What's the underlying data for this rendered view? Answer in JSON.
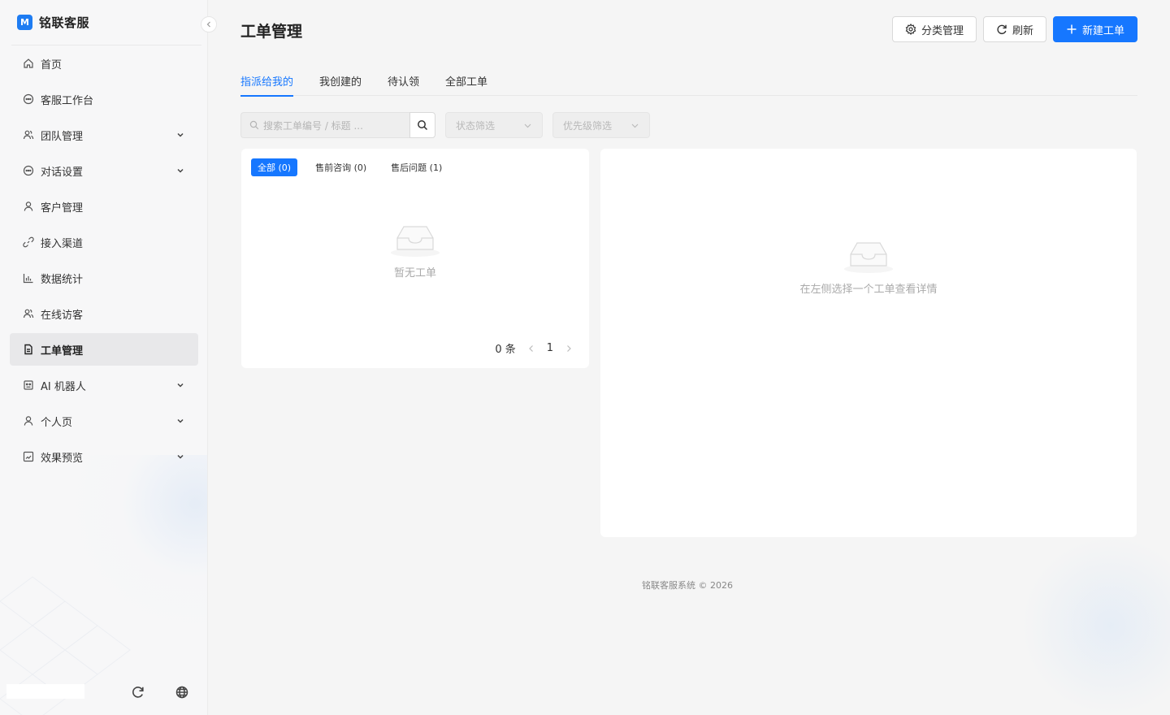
{
  "app": {
    "logo_mark": "M",
    "name": "铭联客服"
  },
  "sidebar": {
    "items": [
      {
        "label": "首页",
        "icon": "home-icon"
      },
      {
        "label": "客服工作台",
        "icon": "chat-icon"
      },
      {
        "label": "团队管理",
        "icon": "team-icon",
        "expandable": true
      },
      {
        "label": "对话设置",
        "icon": "chat-settings-icon",
        "expandable": true
      },
      {
        "label": "客户管理",
        "icon": "user-icon"
      },
      {
        "label": "接入渠道",
        "icon": "link-icon"
      },
      {
        "label": "数据统计",
        "icon": "bar-chart-icon"
      },
      {
        "label": "在线访客",
        "icon": "visitor-icon"
      },
      {
        "label": "工单管理",
        "icon": "ticket-icon",
        "active": true
      },
      {
        "label": "AI 机器人",
        "icon": "robot-icon",
        "expandable": true
      },
      {
        "label": "个人页",
        "icon": "profile-icon",
        "expandable": true
      },
      {
        "label": "效果预览",
        "icon": "preview-icon",
        "expandable": true
      }
    ]
  },
  "header": {
    "title": "工单管理",
    "category_button": "分类管理",
    "refresh_button": "刷新",
    "new_button": "新建工单"
  },
  "tabs": [
    {
      "label": "指派给我的",
      "active": true
    },
    {
      "label": "我创建的"
    },
    {
      "label": "待认领"
    },
    {
      "label": "全部工单"
    }
  ],
  "filters": {
    "search_placeholder": "搜索工单编号 / 标题 ...",
    "status_placeholder": "状态筛选",
    "priority_placeholder": "优先级筛选"
  },
  "list": {
    "categories": [
      {
        "label": "全部 (0)",
        "active": true
      },
      {
        "label": "售前咨询 (0)"
      },
      {
        "label": "售后问题 (1)"
      }
    ],
    "empty_text": "暂无工单",
    "total": "0 条",
    "current_page": "1"
  },
  "detail": {
    "empty_text": "在左侧选择一个工单查看详情"
  },
  "footer": {
    "text": "铭联客服系统 © 2026"
  },
  "colors": {
    "primary": "#1677ff",
    "sidebar_bg": "#f7f7f8",
    "active_item_bg": "#e8e8ea",
    "page_bg": "#f5f5f5"
  }
}
